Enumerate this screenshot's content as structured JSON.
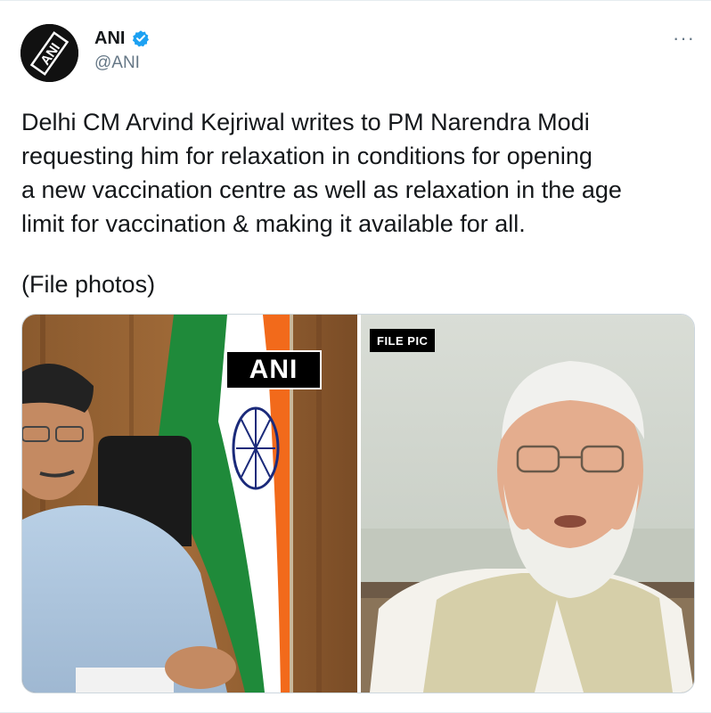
{
  "account": {
    "name": "ANI",
    "handle": "@ANI",
    "avatar_text": "ANI"
  },
  "header": {
    "more_label": "···"
  },
  "tweet": {
    "text": "Delhi CM Arvind Kejriwal writes to PM Narendra Modi\nrequesting him for relaxation in conditions for opening\na new vaccination centre as well as relaxation in the age\nlimit for vaccination & making it available for all.",
    "photo_note": "(File photos)"
  },
  "media": {
    "left_badge": "ANI",
    "right_badge": "FILE PIC"
  },
  "colors": {
    "verified": "#1da1f2",
    "text": "#14171a",
    "secondary": "#657786",
    "flag_saffron": "#f26a1b",
    "flag_green": "#1f8a3a",
    "chakra": "#1b2a7a"
  },
  "icons": {
    "verified": "verified-badge-icon",
    "more": "more-icon"
  }
}
